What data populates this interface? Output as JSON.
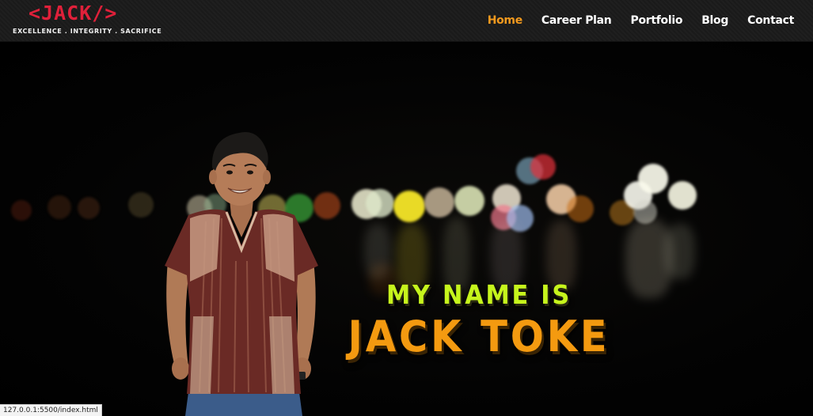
{
  "header": {
    "logo_text": "<JACK/>",
    "tagline": "EXCELLENCE . INTEGRITY . SACRIFICE"
  },
  "nav": {
    "items": [
      {
        "label": "Home",
        "active": true
      },
      {
        "label": "Career Plan",
        "active": false
      },
      {
        "label": "Portfolio",
        "active": false
      },
      {
        "label": "Blog",
        "active": false
      },
      {
        "label": "Contact",
        "active": false
      }
    ]
  },
  "hero": {
    "intro": "MY NAME IS",
    "name": "JACK TOKE"
  },
  "status": {
    "url": "127.0.0.1:5500/index.html"
  },
  "colors": {
    "logo": "#e0203a",
    "nav_active": "#f39a1e",
    "nav_text": "#ffffff",
    "intro_text": "#c6f51c",
    "name_text": "#f49a10"
  }
}
